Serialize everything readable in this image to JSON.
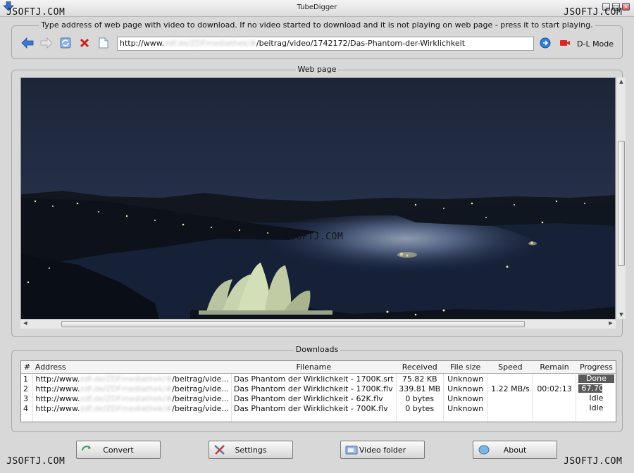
{
  "window": {
    "title": "TubeDigger"
  },
  "watermarks": [
    "JSOFTJ.COM",
    "JSOFTJ.COM",
    "JSOFTJ.COM",
    "JSOFTJ.COM",
    "JSOFTJ.COM"
  ],
  "address_panel": {
    "instructions": "Type address of web page with video to download. If no video started to download and it is not playing on web page - press it to start playing.",
    "url_prefix": "http://www.",
    "url_blurred": "zdf.de/ZDFmediathek/#",
    "url_suffix": "/beitrag/video/1742172/Das-Phantom-der-Wirklichkeit",
    "dl_mode_label": "D-L Mode",
    "icons": [
      "back-icon",
      "forward-icon",
      "refresh-icon",
      "stop-icon",
      "page-icon",
      "go-icon",
      "record-icon"
    ]
  },
  "webpage_panel": {
    "legend": "Web page"
  },
  "downloads_panel": {
    "legend": "Downloads",
    "columns": [
      "#",
      "Address",
      "Filename",
      "Received",
      "File size",
      "Speed",
      "Remain",
      "Progress"
    ],
    "rows": [
      {
        "num": "1",
        "addr_prefix": "http://www.",
        "addr_blur": "zdf.de/ZDFmediathek/#",
        "addr_suffix": "/beitrag/vide...",
        "filename": "Das Phantom der Wirklichkeit - 1700K.srt",
        "received": "75.82 KB",
        "size": "Unknown",
        "speed": "",
        "remain": "",
        "progress": "Done",
        "progress_value": 1.0,
        "progress_style": "done"
      },
      {
        "num": "2",
        "addr_prefix": "http://www.",
        "addr_blur": "zdf.de/ZDFmediathek/#",
        "addr_suffix": "/beitrag/vide...",
        "filename": "Das Phantom der Wirklichkeit - 1700K.flv",
        "received": "339.81 MB",
        "size": "Unknown",
        "speed": "1.22 MB/s",
        "remain": "00:02:13",
        "progress": "67.70%",
        "progress_value": 0.677,
        "progress_style": "partial"
      },
      {
        "num": "3",
        "addr_prefix": "http://www.",
        "addr_blur": "zdf.de/ZDFmediathek/#",
        "addr_suffix": "/beitrag/vide...",
        "filename": "Das Phantom der Wirklichkeit - 62K.flv",
        "received": "0 bytes",
        "size": "Unknown",
        "speed": "",
        "remain": "",
        "progress": "Idle",
        "progress_value": 0,
        "progress_style": "idle"
      },
      {
        "num": "4",
        "addr_prefix": "http://www.",
        "addr_blur": "zdf.de/ZDFmediathek/#",
        "addr_suffix": "/beitrag/vide...",
        "filename": "Das Phantom der Wirklichkeit - 700K.flv",
        "received": "0 bytes",
        "size": "Unknown",
        "speed": "",
        "remain": "",
        "progress": "Idle",
        "progress_value": 0,
        "progress_style": "idle"
      }
    ]
  },
  "buttons": {
    "convert": "Convert",
    "settings": "Settings",
    "video_folder": "Video folder",
    "about": "About"
  },
  "colors": {
    "window_bg": "#d8d8d8",
    "progress_fill": "#5a5a5a",
    "night_sky": "#202a3f"
  }
}
